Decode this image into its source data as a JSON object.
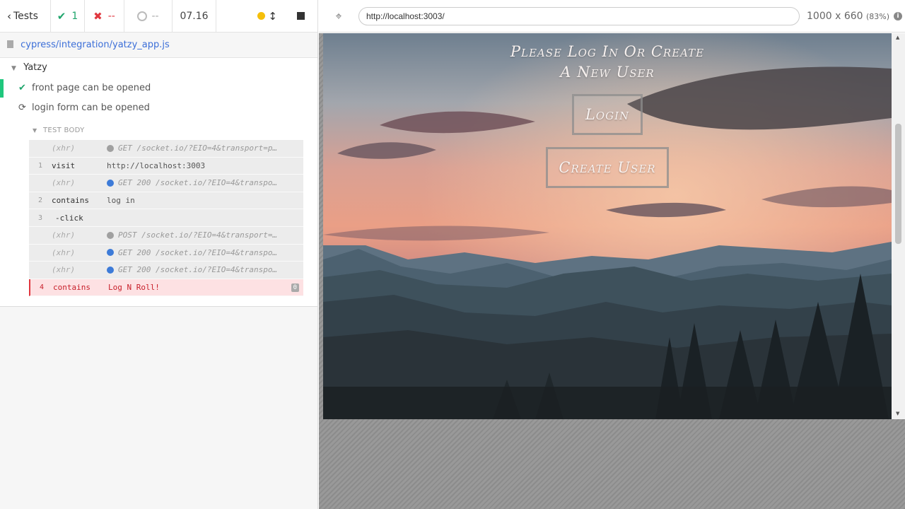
{
  "reporter": {
    "stats": {
      "back_label": "Tests",
      "passed": "1",
      "failed": "--",
      "pending": "--",
      "duration": "07.16"
    },
    "spec_file": "cypress/integration/yatzy_app.js",
    "suite": "Yatzy",
    "tests": [
      {
        "title": "front page can be opened",
        "state": "passed"
      },
      {
        "title": "login form can be opened",
        "state": "running"
      }
    ],
    "test_body_label": "TEST BODY",
    "commands": [
      {
        "num": "",
        "name": "(xhr)",
        "dot": "grey",
        "message": "GET /socket.io/?EIO=4&transport=p…",
        "state": "xhr"
      },
      {
        "num": "1",
        "name": "visit",
        "dot": "",
        "message": "http://localhost:3003",
        "state": "normal"
      },
      {
        "num": "",
        "name": "(xhr)",
        "dot": "blue",
        "message": "GET 200 /socket.io/?EIO=4&transpo…",
        "state": "xhr"
      },
      {
        "num": "2",
        "name": "contains",
        "dot": "",
        "message": "log in",
        "state": "normal"
      },
      {
        "num": "3",
        "name": "-click",
        "dot": "",
        "message": "",
        "state": "child"
      },
      {
        "num": "",
        "name": "(xhr)",
        "dot": "grey",
        "message": "POST /socket.io/?EIO=4&transport=…",
        "state": "xhr"
      },
      {
        "num": "",
        "name": "(xhr)",
        "dot": "blue",
        "message": "GET 200 /socket.io/?EIO=4&transpo…",
        "state": "xhr"
      },
      {
        "num": "",
        "name": "(xhr)",
        "dot": "blue",
        "message": "GET 200 /socket.io/?EIO=4&transpo…",
        "state": "xhr"
      },
      {
        "num": "4",
        "name": "contains",
        "dot": "",
        "message": "Log N Roll!",
        "state": "failing",
        "badge": "0"
      }
    ]
  },
  "browser": {
    "url": "http://localhost:3003/",
    "viewport": "1000 x 660",
    "scale": "(83%)"
  },
  "app": {
    "heading_line1": "Please Log In Or Create",
    "heading_line2": "A New User",
    "login_button": "Login",
    "create_user_button": "Create User"
  },
  "colors": {
    "pass": "#1fa56c",
    "fail": "#e0373f",
    "link": "#3c6fd8",
    "running": "#f5bf0a"
  }
}
